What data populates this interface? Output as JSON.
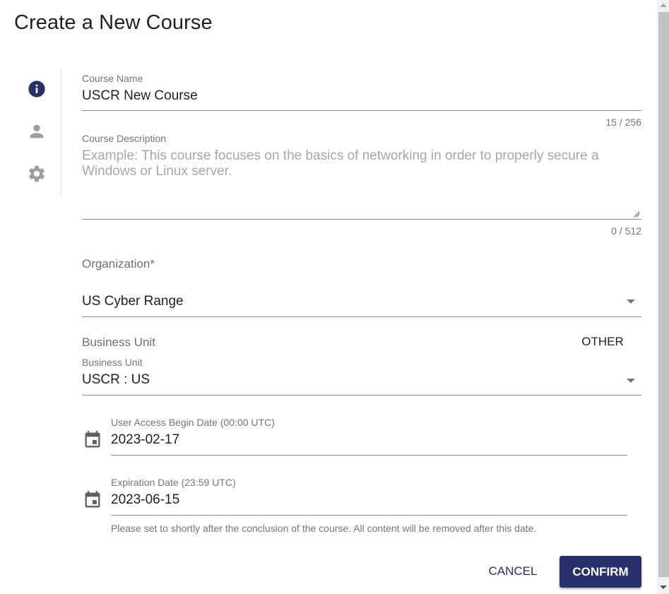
{
  "dialog": {
    "title": "Create a New Course"
  },
  "stepper": {
    "steps": [
      {
        "name": "info",
        "icon": "info-icon",
        "active": true
      },
      {
        "name": "users",
        "icon": "person-icon",
        "active": false
      },
      {
        "name": "settings",
        "icon": "gear-icon",
        "active": false
      }
    ]
  },
  "form": {
    "course_name": {
      "label": "Course Name",
      "value": "USCR New Course",
      "counter": "15 / 256"
    },
    "course_description": {
      "label": "Course Description",
      "placeholder": "Example: This course focuses on the basics of networking in order to properly secure a Windows or Linux server.",
      "value": "",
      "counter": "0 / 512"
    },
    "organization": {
      "label": "Organization*",
      "value": "US Cyber Range"
    },
    "business_unit": {
      "section_label": "Business Unit",
      "toggle_label": "OTHER",
      "label": "Business Unit",
      "value": "USCR : US"
    },
    "begin_date": {
      "label": "User Access Begin Date (00:00 UTC)",
      "value": "2023-02-17"
    },
    "expiration_date": {
      "label": "Expiration Date (23:59 UTC)",
      "value": "2023-06-15",
      "hint": "Please set to shortly after the conclusion of the course. All content will be removed after this date."
    }
  },
  "actions": {
    "cancel_label": "CANCEL",
    "confirm_label": "CONFIRM"
  },
  "colors": {
    "primary": "#27306b",
    "text": "#212121",
    "muted": "#757575",
    "inactive_icon": "#9e9e9e"
  }
}
